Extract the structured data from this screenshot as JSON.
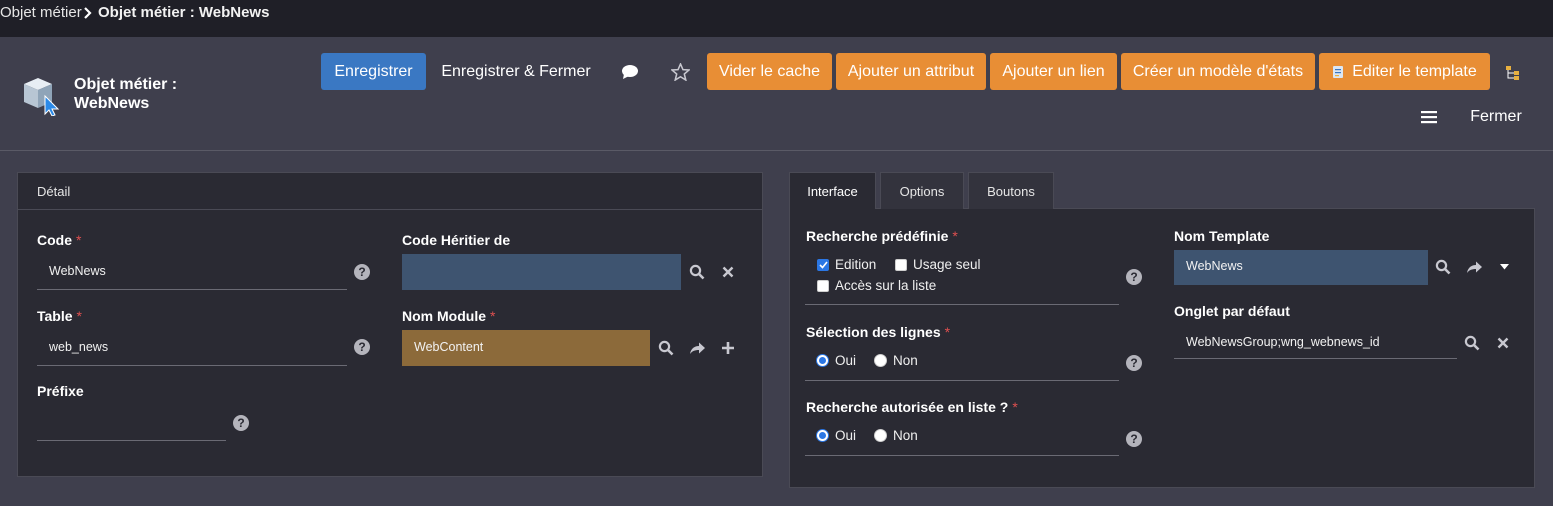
{
  "breadcrumb": {
    "parent": "Objet métier",
    "current": "Objet métier : WebNews"
  },
  "header": {
    "title_line1": "Objet métier :",
    "title_line2": "WebNews",
    "buttons": {
      "save": "Enregistrer",
      "save_close": "Enregistrer & Fermer",
      "clear_cache": "Vider le cache",
      "add_attribute": "Ajouter un attribut",
      "add_link": "Ajouter un lien",
      "create_state_model": "Créer un modèle d'états",
      "edit_template": "Editer le template",
      "close": "Fermer"
    }
  },
  "detail": {
    "title": "Détail",
    "code": {
      "label": "Code",
      "value": "WebNews",
      "required": "*"
    },
    "table": {
      "label": "Table",
      "value": "web_news",
      "required": "*"
    },
    "prefix": {
      "label": "Préfixe",
      "value": ""
    },
    "inherits": {
      "label": "Code Héritier de",
      "value": ""
    },
    "module": {
      "label": "Nom Module",
      "value": "WebContent",
      "required": "*"
    }
  },
  "tabs": [
    "Interface",
    "Options",
    "Boutons"
  ],
  "interface": {
    "predefined_search": {
      "label": "Recherche prédéfinie",
      "required": "*",
      "options": [
        {
          "label": "Edition",
          "checked": true
        },
        {
          "label": "Usage seul",
          "checked": false
        },
        {
          "label": "Accès sur la liste",
          "checked": false
        }
      ]
    },
    "row_selection": {
      "label": "Sélection des lignes",
      "required": "*",
      "yes": "Oui",
      "no": "Non",
      "selected": "Oui"
    },
    "list_search": {
      "label": "Recherche autorisée en liste ?",
      "required": "*",
      "yes": "Oui",
      "no": "Non",
      "selected": "Oui"
    },
    "template_name": {
      "label": "Nom Template",
      "value": "WebNews"
    },
    "default_tab": {
      "label": "Onglet par défaut",
      "value": "WebNewsGroup;wng_webnews_id"
    }
  },
  "colors": {
    "primary": "#3a78c3",
    "orange": "#e88e35",
    "field_blue": "#3e5470",
    "field_brown": "#8c6a3a",
    "required": "#e05050"
  },
  "icons": {
    "help": "?",
    "search": "search-icon",
    "clear": "close-icon",
    "open": "share-arrow-icon",
    "add": "plus-icon"
  }
}
